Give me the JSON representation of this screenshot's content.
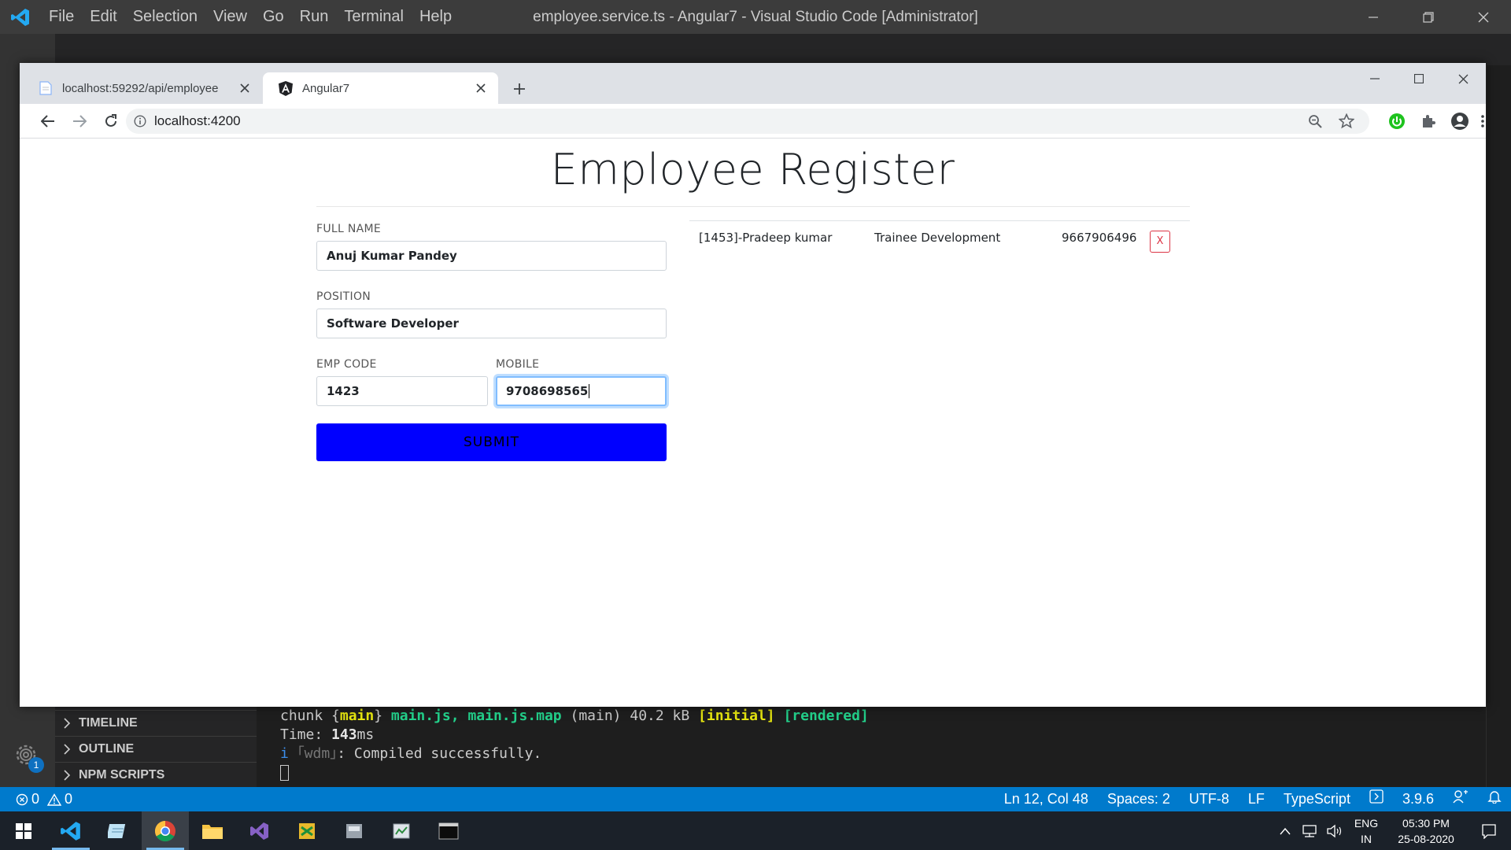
{
  "vscode": {
    "menu": [
      "File",
      "Edit",
      "Selection",
      "View",
      "Go",
      "Run",
      "Terminal",
      "Help"
    ],
    "window_title": "employee.service.ts - Angular7 - Visual Studio Code [Administrator]",
    "sidebar_sections": [
      "TIMELINE",
      "OUTLINE",
      "NPM SCRIPTS"
    ],
    "settings_badge": "1",
    "terminal": {
      "line1": {
        "prefix": "chunk {",
        "main": "main",
        "mid": "} ",
        "files": "main.js, main.js.map",
        "size": " (main) 40.2 kB ",
        "initial": "[initial]",
        "rendered": "[rendered]"
      },
      "line2": {
        "label": "Time: ",
        "value": "143",
        "unit": "ms"
      },
      "line3": {
        "info": "i",
        "wdm": "｢wdm｣",
        "msg": ": Compiled successfully."
      }
    },
    "statusbar": {
      "errors": "0",
      "warnings": "0",
      "position": "Ln 12, Col 48",
      "spaces": "Spaces: 2",
      "encoding": "UTF-8",
      "eol": "LF",
      "language": "TypeScript",
      "version": "3.9.6"
    }
  },
  "chrome": {
    "tabs": [
      {
        "title": "localhost:59292/api/employee",
        "icon": "document-icon"
      },
      {
        "title": "Angular7",
        "icon": "angular-icon",
        "active": true
      }
    ],
    "url": "localhost:4200"
  },
  "page": {
    "title": "Employee Register",
    "form": {
      "full_name_label": "FULL NAME",
      "full_name_value": "Anuj Kumar Pandey",
      "position_label": "POSITION",
      "position_value": "Software Developer",
      "emp_code_label": "EMP CODE",
      "emp_code_value": "1423",
      "mobile_label": "MOBILE",
      "mobile_value": "9708698565",
      "submit_label": "SUBMIT"
    },
    "employees": [
      {
        "name": "[1453]-Pradeep kumar",
        "position": "Trainee Development",
        "mobile": "9667906496",
        "delete_label": "X"
      }
    ]
  },
  "taskbar": {
    "language": "ENG",
    "region": "IN",
    "time": "05:30 PM",
    "date": "25-08-2020"
  }
}
